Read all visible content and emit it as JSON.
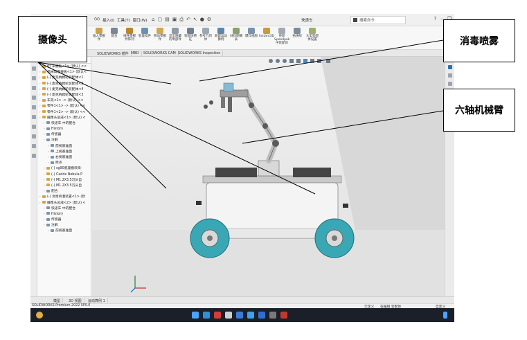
{
  "menu": [
    "(V)",
    "插入(I)",
    "工具(T)",
    "窗口(W)"
  ],
  "document_title": "快递车",
  "search": {
    "placeholder": "搜索命令"
  },
  "ribbon_buttons": [
    "插入零部件",
    "配合",
    "线性零部件阵列",
    "智能扣件",
    "移动零部件",
    "显示隐藏的零部件",
    "装配体特征",
    "参考几何体",
    "新建运动算例",
    "材料明细表",
    "爆炸视图",
    "Instant3D",
    "更新Speedpak子装配体",
    "拍快照",
    "大型装配体设置"
  ],
  "command_tabs": [
    "SOLIDWORKS 插件",
    "MBD",
    "SOLIDWORKS CAM",
    "SOLIDWORKS Inspection"
  ],
  "tree": {
    "items": [
      {
        "label": "(f) 车底板<1> (默认) <<",
        "icon": "part",
        "level": 0
      },
      {
        "label": "机械臂连接板<1> (默认<",
        "icon": "part",
        "level": 0
      },
      {
        "label": "(-) 麦克纳姆轮装配体<1",
        "icon": "part",
        "level": 0
      },
      {
        "label": "(-) 麦克纳姆轮装配体<2",
        "icon": "part",
        "level": 0
      },
      {
        "label": "(-) 麦克纳姆轮装配体<4",
        "icon": "part",
        "level": 0
      },
      {
        "label": "(-) 麦克纳姆轮装配体<3",
        "icon": "part",
        "level": 0
      },
      {
        "label": "车壳<1> -> (默认) <<",
        "icon": "part",
        "level": 0
      },
      {
        "label": "零件1<1> -> (默认) <<",
        "icon": "part",
        "level": 0
      },
      {
        "label": "零件1<2> -> (默认) <<",
        "icon": "part",
        "level": 0
      },
      {
        "label": "摄像头总成<1> (默认) <",
        "icon": "part",
        "level": 0
      },
      {
        "label": "快递车 中的配合",
        "icon": "doc",
        "level": 1
      },
      {
        "label": "History",
        "icon": "doc",
        "level": 1
      },
      {
        "label": "传感器",
        "icon": "doc",
        "level": 1
      },
      {
        "label": "注解",
        "icon": "doc",
        "level": 1
      },
      {
        "label": "前视基准面",
        "icon": "doc",
        "level": 2
      },
      {
        "label": "上视基准面",
        "icon": "doc",
        "level": 2
      },
      {
        "label": "右视基准面",
        "icon": "doc",
        "level": 2
      },
      {
        "label": "原点",
        "icon": "doc",
        "level": 2
      },
      {
        "label": "(-) sg90底座模块简·",
        "icon": "part",
        "level": 1
      },
      {
        "label": "(-) Caddx Nebula P",
        "icon": "part",
        "level": 1
      },
      {
        "label": "(-) M1.2X3.5沉头自",
        "icon": "part",
        "level": 1
      },
      {
        "label": "(-) M1.2X3.5沉头自",
        "icon": "part",
        "level": 1
      },
      {
        "label": "配合",
        "icon": "doc",
        "level": 1
      },
      {
        "label": "(-) 消毒喷洒装置<1> (默",
        "icon": "part",
        "level": 0
      },
      {
        "label": "摄像头总成<2> (默认) <",
        "icon": "part",
        "level": 0
      },
      {
        "label": "快递车 中的配合",
        "icon": "doc",
        "level": 1
      },
      {
        "label": "History",
        "icon": "doc",
        "level": 1
      },
      {
        "label": "传感器",
        "icon": "doc",
        "level": 1
      },
      {
        "label": "注解",
        "icon": "doc",
        "level": 1
      },
      {
        "label": "前视基准面",
        "icon": "doc",
        "level": 2
      }
    ]
  },
  "bottom_tabs": [
    "模型",
    "3D 视图",
    "运动算例 1"
  ],
  "status": {
    "left": "SOLIDWORKS Premium 2022 SP0.0",
    "mode": "欠定义",
    "editing": "在编辑 装配体",
    "units": "自定义"
  },
  "callouts": {
    "camera": "摄像头",
    "spray": "消毒喷雾",
    "arm": "六轴机械臂"
  },
  "colors": {
    "wheel_teal": "#3aa7b5",
    "accent_blue": "#1e88e5"
  }
}
